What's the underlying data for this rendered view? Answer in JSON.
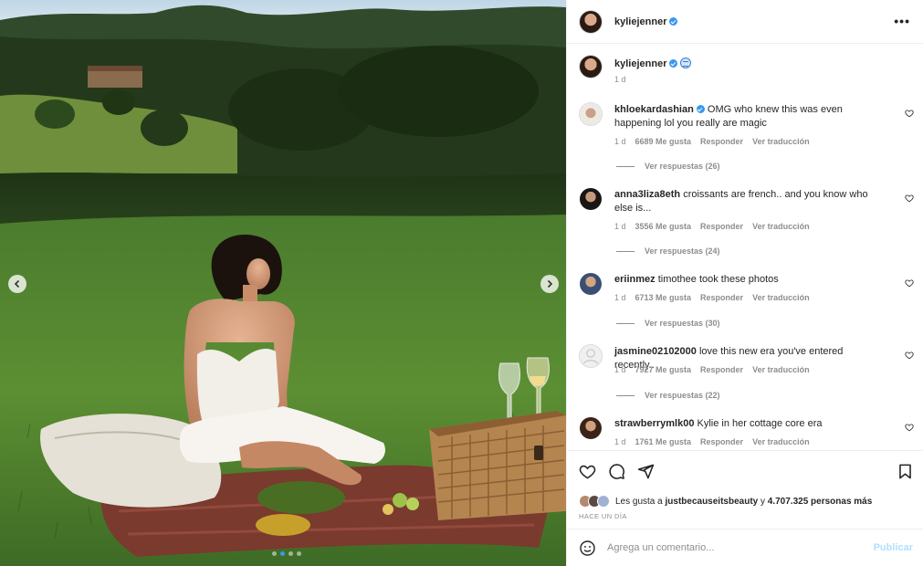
{
  "post": {
    "username": "kyliejenner",
    "caption_time": "1 d",
    "more_icon": "more-horizontal-icon"
  },
  "comments": [
    {
      "username": "khloekardashian",
      "verified": true,
      "text": "OMG who knew this was even happening lol you really are magic",
      "time": "1 d",
      "likes": "6689 Me gusta",
      "reply": "Responder",
      "translate": "Ver traducción",
      "view_replies": "Ver respuestas (26)"
    },
    {
      "username": "anna3liza8eth",
      "verified": false,
      "text": "croissants are french.. and you know who else is...",
      "time": "1 d",
      "likes": "3556 Me gusta",
      "reply": "Responder",
      "translate": "Ver traducción",
      "view_replies": "Ver respuestas (24)"
    },
    {
      "username": "eriinmez",
      "verified": false,
      "text": "timothee took these photos",
      "time": "1 d",
      "likes": "6713 Me gusta",
      "reply": "Responder",
      "translate": "Ver traducción",
      "view_replies": "Ver respuestas (30)"
    },
    {
      "username": "jasmine02102000",
      "verified": false,
      "text": "love this new era you've entered recently..",
      "time": "1 d",
      "likes": "7927 Me gusta",
      "reply": "Responder",
      "translate": "Ver traducción",
      "view_replies": "Ver respuestas (22)"
    },
    {
      "username": "strawberrymlk00",
      "verified": false,
      "text": "Kylie in her cottage core era",
      "time": "1 d",
      "likes": "1761 Me gusta",
      "reply": "Responder",
      "translate": "Ver traducción",
      "view_replies": ""
    }
  ],
  "actions": {
    "likes_prefix": "Les gusta a ",
    "likes_user": "justbecauseitsbeauty",
    "likes_middle": " y ",
    "likes_count": "4.707.325 personas más",
    "date": "HACE UN DÍA"
  },
  "comment_box": {
    "placeholder": "Agrega un comentario...",
    "publish": "Publicar"
  },
  "carousel": {
    "total": 4,
    "active": 2
  },
  "colors": {
    "accent": "#3897f0",
    "muted": "#8e8e8e",
    "publish_disabled": "#b2dffc"
  }
}
